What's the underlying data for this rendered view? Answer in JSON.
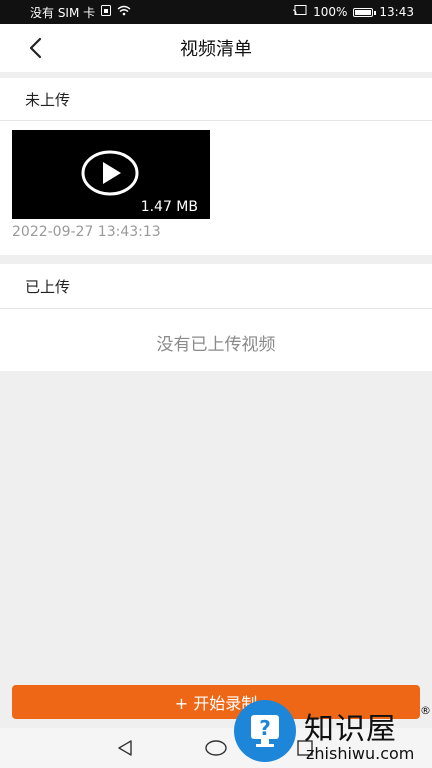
{
  "status_bar": {
    "carrier": "没有 SIM 卡",
    "battery": "100%",
    "time": "13:43"
  },
  "header": {
    "title": "视频清单"
  },
  "not_uploaded": {
    "label": "未上传",
    "videos": [
      {
        "size": "1.47 MB",
        "timestamp": "2022-09-27 13:43:13"
      }
    ]
  },
  "uploaded": {
    "label": "已上传",
    "empty_message": "没有已上传视频"
  },
  "record_button": {
    "label": "+ 开始录制"
  },
  "watermark": {
    "brand_cn": "知识屋",
    "brand_en": "zhishiwu.com",
    "reg_mark": "®"
  },
  "colors": {
    "accent": "#ee6716",
    "watermark_blue": "#1e86d9"
  }
}
